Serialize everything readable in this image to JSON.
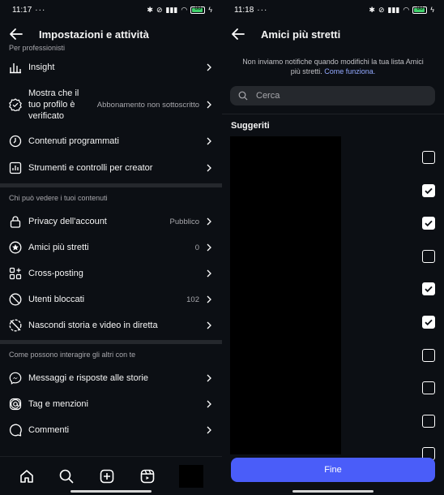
{
  "left": {
    "status": {
      "time": "11:17",
      "dots": "···",
      "battery": "88"
    },
    "title": "Impostazioni e attività",
    "sections": [
      {
        "head": "Per professionisti",
        "rows": [
          {
            "icon": "insight-icon",
            "label": "Insight",
            "value": ""
          },
          {
            "icon": "verified-badge-icon",
            "label": "Mostra che il tuo profilo è verificato",
            "value": "Abbonamento non sottoscritto"
          },
          {
            "icon": "clock-icon",
            "label": "Contenuti programmati",
            "value": ""
          },
          {
            "icon": "bar-chart-icon",
            "label": "Strumenti e controlli per creator",
            "value": ""
          }
        ]
      },
      {
        "head": "Chi può vedere i tuoi contenuti",
        "rows": [
          {
            "icon": "lock-icon",
            "label": "Privacy dell'account",
            "value": "Pubblico"
          },
          {
            "icon": "star-circle-icon",
            "label": "Amici più stretti",
            "value": "0"
          },
          {
            "icon": "cross-posting-icon",
            "label": "Cross-posting",
            "value": ""
          },
          {
            "icon": "blocked-icon",
            "label": "Utenti bloccati",
            "value": "102"
          },
          {
            "icon": "hide-story-icon",
            "label": "Nascondi storia e video in diretta",
            "value": ""
          }
        ]
      },
      {
        "head": "Come possono interagire gli altri con te",
        "rows": [
          {
            "icon": "messenger-icon",
            "label": "Messaggi e risposte alle storie",
            "value": ""
          },
          {
            "icon": "at-icon",
            "label": "Tag e menzioni",
            "value": ""
          },
          {
            "icon": "comment-icon",
            "label": "Commenti",
            "value": ""
          }
        ]
      }
    ],
    "nav": [
      "home-icon",
      "search-icon",
      "create-icon",
      "reels-icon",
      "profile-avatar"
    ]
  },
  "right": {
    "status": {
      "time": "11:18",
      "dots": "···",
      "battery": "88"
    },
    "title": "Amici più stretti",
    "info_text": "Non inviamo notifiche quando modifichi la tua lista Amici più stretti.",
    "info_link": "Come funziona.",
    "search_placeholder": "Cerca",
    "suggested_label": "Suggeriti",
    "checkboxes": [
      false,
      true,
      true,
      false,
      true,
      true,
      false,
      false,
      false,
      false
    ],
    "done_label": "Fine"
  }
}
